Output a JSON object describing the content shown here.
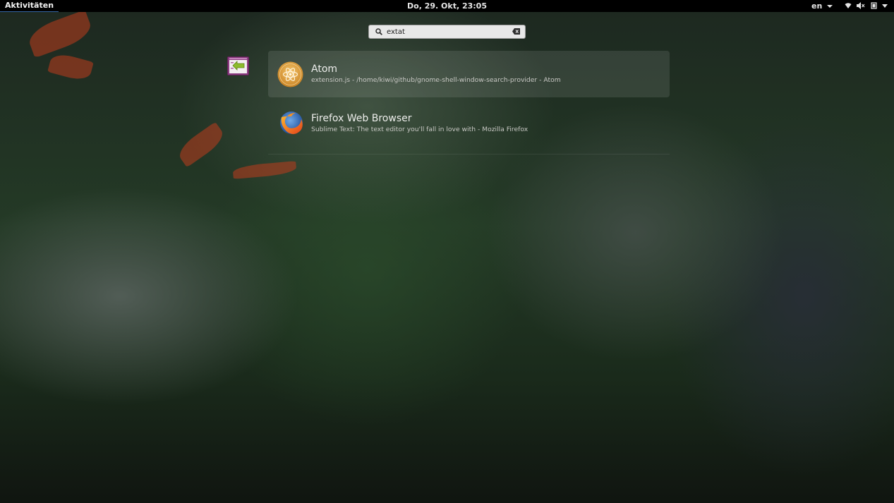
{
  "topbar": {
    "activities_label": "Aktivitäten",
    "clock": "Do, 29. Okt, 23:05",
    "language": "en",
    "tray_icons": [
      "wifi-icon",
      "volume-muted-icon",
      "battery-icon",
      "system-menu-arrow-icon"
    ]
  },
  "search": {
    "value": "extat",
    "icon": "search-icon",
    "clear_icon": "clear-icon"
  },
  "provider": {
    "icon": "window-switch-icon",
    "accent": "#9b3d8c"
  },
  "results": [
    {
      "title": "Atom",
      "description": "extension.js - /home/kiwi/github/gnome-shell-window-search-provider - Atom",
      "icon": "atom-icon",
      "selected": true
    },
    {
      "title": "Firefox Web Browser",
      "description": "Sublime Text: The text editor you'll fall in love with - Mozilla Firefox",
      "icon": "firefox-icon",
      "selected": false
    }
  ],
  "colors": {
    "topbar_bg": "#000000",
    "activities_underline": "#3465a4",
    "atom_icon": "#e8a43a",
    "firefox_orange": "#f36f1a",
    "firefox_blue": "#1f4f9b"
  }
}
